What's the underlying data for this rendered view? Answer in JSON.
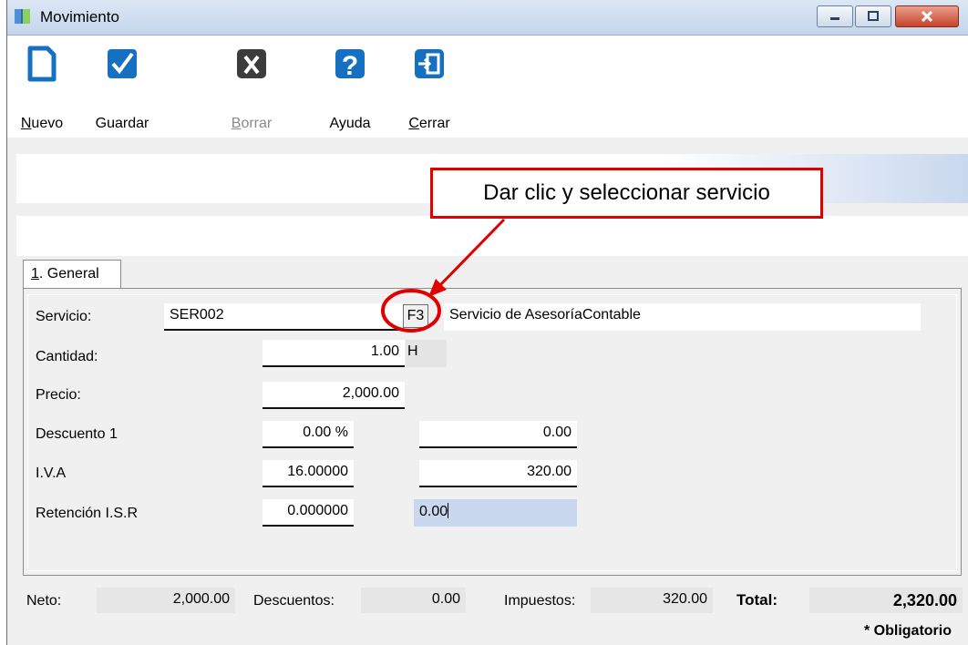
{
  "window": {
    "title": "Movimiento"
  },
  "toolbar": {
    "nuevo": {
      "label_u": "N",
      "label_rest": "uevo",
      "icon": "new-document-icon"
    },
    "guardar": {
      "label": "Guardar",
      "icon": "checkmark-icon"
    },
    "borrar": {
      "label_u": "B",
      "label_rest": "orrar",
      "icon": "delete-x-icon",
      "disabled": true
    },
    "ayuda": {
      "label": "Ayuda",
      "icon": "help-question-icon"
    },
    "cerrar": {
      "label_u": "C",
      "label_rest": "errar",
      "icon": "exit-door-icon"
    }
  },
  "tabs": [
    {
      "label_u": "1",
      "label_rest": ". General"
    }
  ],
  "form": {
    "servicio": {
      "label": "Servicio:",
      "code": "SER002",
      "lookup_label": "F3",
      "description": "Servicio de AsesoríaContable"
    },
    "cantidad": {
      "label": "Cantidad:",
      "value": "1.00",
      "unit": "H"
    },
    "precio": {
      "label": "Precio:",
      "value": "2,000.00"
    },
    "descuento1": {
      "label": "Descuento 1",
      "percent": "0.00 %",
      "amount": "0.00"
    },
    "iva": {
      "label": "I.V.A",
      "rate": "16.00000",
      "amount": "320.00"
    },
    "retencion_isr": {
      "label": "Retención I.S.R",
      "rate": "0.000000",
      "amount": "0.00"
    }
  },
  "footer": {
    "neto": {
      "label": "Neto:",
      "value": "2,000.00"
    },
    "descuentos": {
      "label": "Descuentos:",
      "value": "0.00"
    },
    "impuestos": {
      "label": "Impuestos:",
      "value": "320.00"
    },
    "total": {
      "label": "Total:",
      "value": "2,320.00"
    },
    "note": "* Obligatorio"
  },
  "annotation": {
    "text": "Dar clic y seleccionar servicio",
    "color": "#e00000"
  }
}
